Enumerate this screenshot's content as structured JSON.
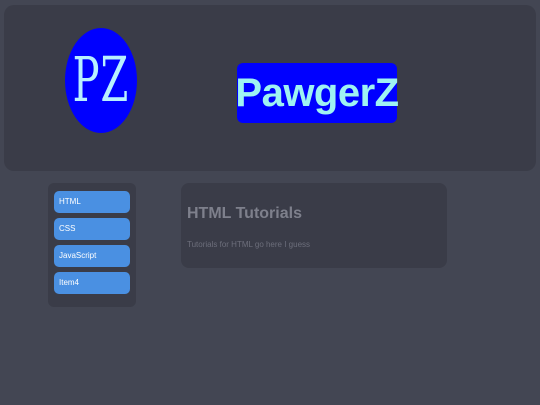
{
  "header": {
    "logo_text": "PZ",
    "brand_name": "PawgerZ"
  },
  "sidebar": {
    "items": [
      {
        "label": "HTML"
      },
      {
        "label": "CSS"
      },
      {
        "label": "JavaScript"
      },
      {
        "label": "Item4"
      }
    ]
  },
  "main": {
    "title": "HTML Tutorials",
    "body": "Tutorials for HTML go here I guess"
  },
  "colors": {
    "page_bg": "#434653",
    "panel_bg": "#3a3c48",
    "brand_blue": "#0000ff",
    "brand_text": "#9ff3f2",
    "nav_button": "#4a90e2"
  }
}
